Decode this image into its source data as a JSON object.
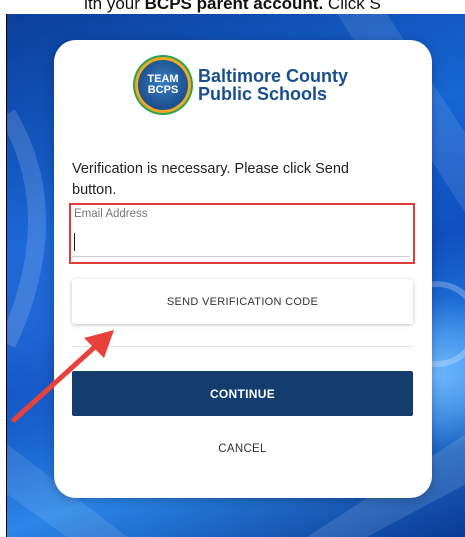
{
  "caption": {
    "prefix": "ith your ",
    "bold": "BCPS parent account.",
    "suffix": " Click S"
  },
  "logo": {
    "badge_line1": "TEAM",
    "badge_line2": "BCPS",
    "name_line1": "Baltimore County",
    "name_line2": "Public Schools"
  },
  "form": {
    "instruction": "Verification is necessary. Please click Send button.",
    "email_label": "Email Address",
    "email_value": "",
    "send_label": "SEND VERIFICATION CODE",
    "continue_label": "CONTINUE",
    "cancel_label": "CANCEL"
  },
  "colors": {
    "primary": "#133d6e",
    "highlight": "#e23b3b",
    "arrow": "#e8413c"
  },
  "icons": {
    "logo": "bcps-logo-icon",
    "annotation": "arrow-icon"
  }
}
